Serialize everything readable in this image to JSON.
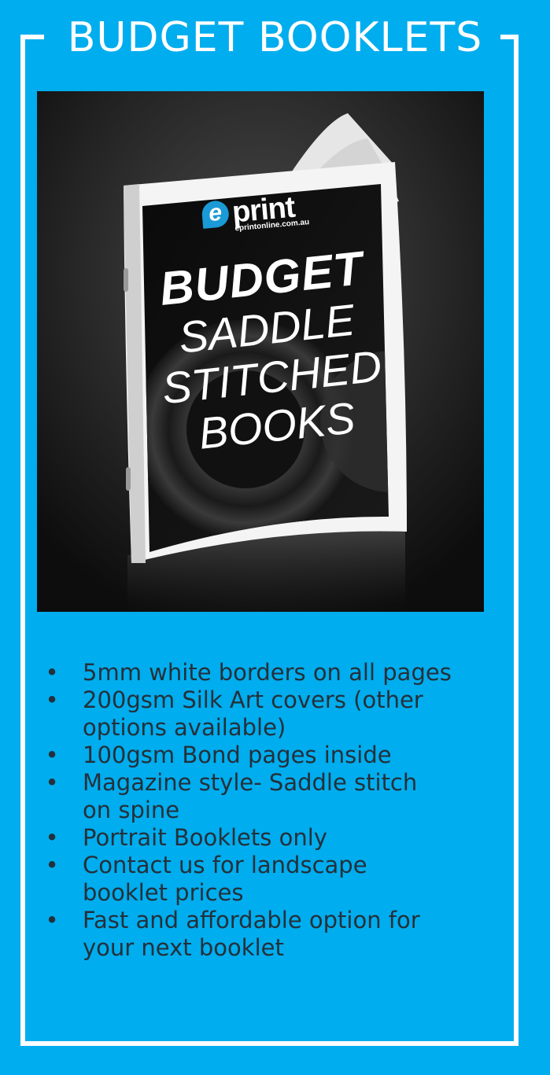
{
  "title": "BUDGET BOOKLETS",
  "brand": {
    "logo_letter": "e",
    "logo_word": "print",
    "logo_url": "eprintonline.com.au"
  },
  "cover": {
    "line1": "BUDGET",
    "line2": "SADDLE",
    "line3": "STITCHED",
    "line4": "BOOKS"
  },
  "features": [
    "5mm white borders on all pages",
    "200gsm Silk Art covers (other options available)",
    "100gsm Bond pages inside",
    "Magazine style- Saddle stitch on spine",
    "Portrait Booklets only",
    "Contact us for landscape booklet prices",
    "Fast and affordable option for your next booklet"
  ],
  "colors": {
    "background": "#00adee",
    "frame": "#ffffff",
    "text": "#24303a",
    "logo_blue": "#1a9ad6"
  }
}
